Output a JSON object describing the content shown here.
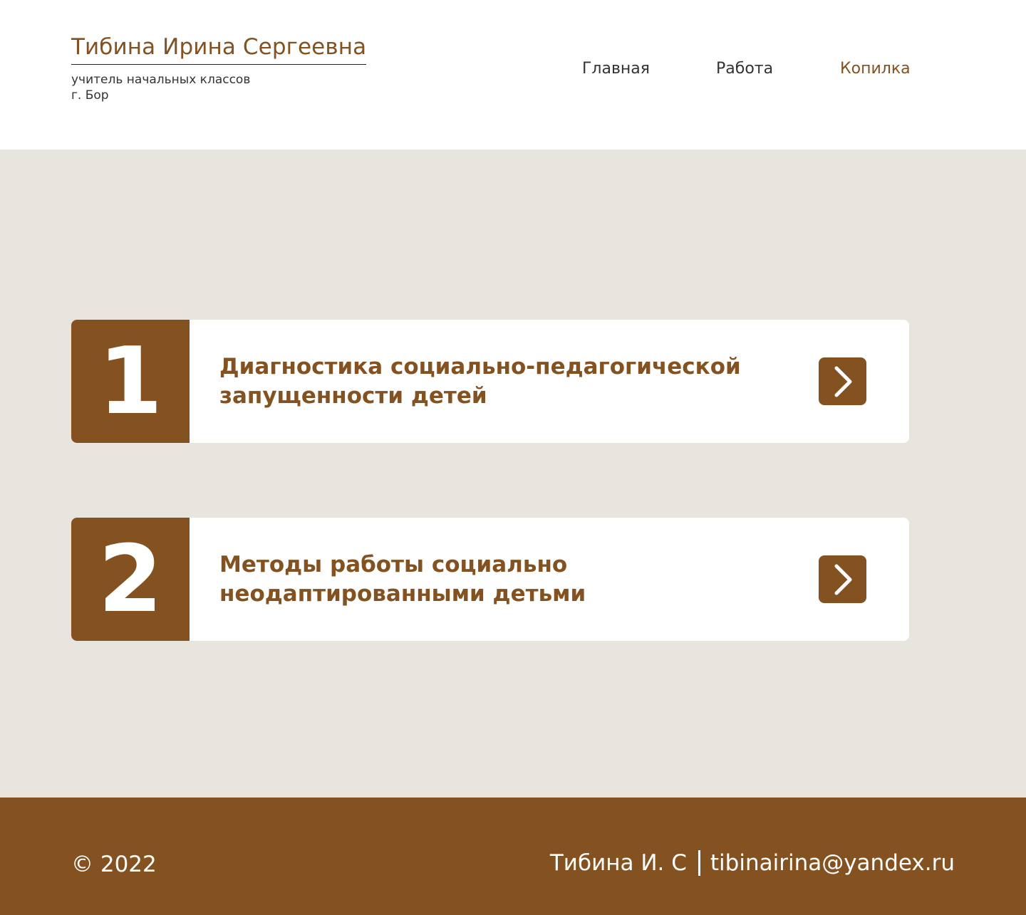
{
  "header": {
    "name": "Тибина Ирина Сергеевна",
    "position": "учитель начальных классов",
    "city": "г. Бор",
    "nav": [
      {
        "label": "Главная",
        "active": false
      },
      {
        "label": "Работа",
        "active": false
      },
      {
        "label": "Копилка",
        "active": true
      }
    ]
  },
  "cards": [
    {
      "number": "1",
      "title": "Диагностика социально-педагогической запущенности детей",
      "arrow_icon": "chevron-right-icon"
    },
    {
      "number": "2",
      "title": "Методы работы социально неодаптированными детьми",
      "arrow_icon": "chevron-right-icon"
    }
  ],
  "footer": {
    "copyright": "© 2022",
    "author": "Тибина И. С",
    "email": "tibinairina@yandex.ru"
  },
  "colors": {
    "accent": "#845220",
    "background": "#e8e5df",
    "card": "#ffffff",
    "text": "#333333"
  }
}
